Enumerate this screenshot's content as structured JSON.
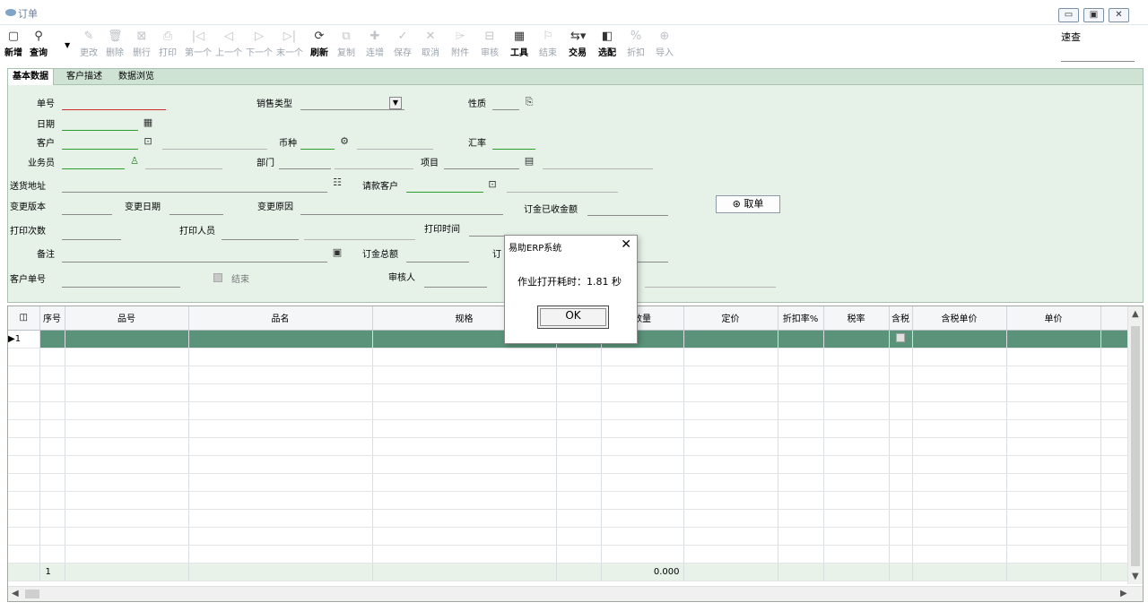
{
  "window": {
    "title": "订单",
    "buttons": [
      "minimize",
      "restore",
      "close"
    ]
  },
  "toolbar": {
    "items": [
      {
        "label": "新增",
        "icon": "new-doc-icon",
        "enabled": true
      },
      {
        "label": "查询",
        "icon": "search-icon",
        "enabled": true
      },
      {
        "label": "更改",
        "icon": "pencil-icon",
        "enabled": false
      },
      {
        "label": "删除",
        "icon": "trash-icon",
        "enabled": false
      },
      {
        "label": "删行",
        "icon": "delete-row-icon",
        "enabled": false
      },
      {
        "label": "打印",
        "icon": "printer-icon",
        "enabled": false
      },
      {
        "label": "第一个",
        "icon": "first-icon",
        "enabled": false
      },
      {
        "label": "上一个",
        "icon": "prev-icon",
        "enabled": false
      },
      {
        "label": "下一个",
        "icon": "next-icon",
        "enabled": false
      },
      {
        "label": "末一个",
        "icon": "last-icon",
        "enabled": false
      },
      {
        "label": "刷新",
        "icon": "refresh-icon",
        "enabled": true
      },
      {
        "label": "复制",
        "icon": "copy-icon",
        "enabled": false
      },
      {
        "label": "连增",
        "icon": "add-continuous-icon",
        "enabled": false
      },
      {
        "label": "保存",
        "icon": "save-icon",
        "enabled": false
      },
      {
        "label": "取消",
        "icon": "cancel-icon",
        "enabled": false
      },
      {
        "label": "附件",
        "icon": "attachment-icon",
        "enabled": false
      },
      {
        "label": "审核",
        "icon": "audit-icon",
        "enabled": false
      },
      {
        "label": "工具",
        "icon": "tools-icon",
        "enabled": true
      },
      {
        "label": "结束",
        "icon": "flag-icon",
        "enabled": false
      },
      {
        "label": "交易",
        "icon": "trade-icon",
        "enabled": true
      },
      {
        "label": "选配",
        "icon": "select-config-icon",
        "enabled": true
      },
      {
        "label": "折扣",
        "icon": "discount-icon",
        "enabled": false
      },
      {
        "label": "导入",
        "icon": "import-icon",
        "enabled": false
      }
    ],
    "quick_search_label": "速查"
  },
  "tabs": [
    "基本数据",
    "客户描述",
    "数据浏览"
  ],
  "form": {
    "order_no": "单号",
    "sales_type": "销售类型",
    "nature": "性质",
    "date": "日期",
    "customer": "客户",
    "currency": "币种",
    "exchange_rate": "汇率",
    "salesman": "业务员",
    "department": "部门",
    "project": "项目",
    "delivery_address": "送货地址",
    "payment_customer": "请款客户",
    "change_version": "变更版本",
    "change_date": "变更日期",
    "change_reason": "变更原因",
    "deposit_received": "订金已收金额",
    "fetch_order_button": "取单",
    "print_count": "打印次数",
    "printed_by": "打印人员",
    "print_time": "打印时间",
    "remarks": "备注",
    "deposit_total": "订金总额",
    "deposit_hidden": "订",
    "customer_order_no": "客户单号",
    "closed": "结束",
    "auditor": "审核人"
  },
  "grid": {
    "columns": [
      "",
      "序号",
      "品号",
      "品名",
      "规格",
      "",
      "数量",
      "定价",
      "折扣率%",
      "税率",
      "含税",
      "含税单价",
      "单价"
    ],
    "current_row": "1",
    "footer_row_count": "1",
    "footer_quantity": "0.000"
  },
  "dialog": {
    "title": "易助ERP系统",
    "message": "作业打开耗时：1.81 秒",
    "ok_label": "OK"
  },
  "colors": {
    "form_bg": "#e6f2e8",
    "selected_row": "#5a937a",
    "required_underline": "#d02a2a",
    "lookup_underline": "#2ba12b"
  }
}
